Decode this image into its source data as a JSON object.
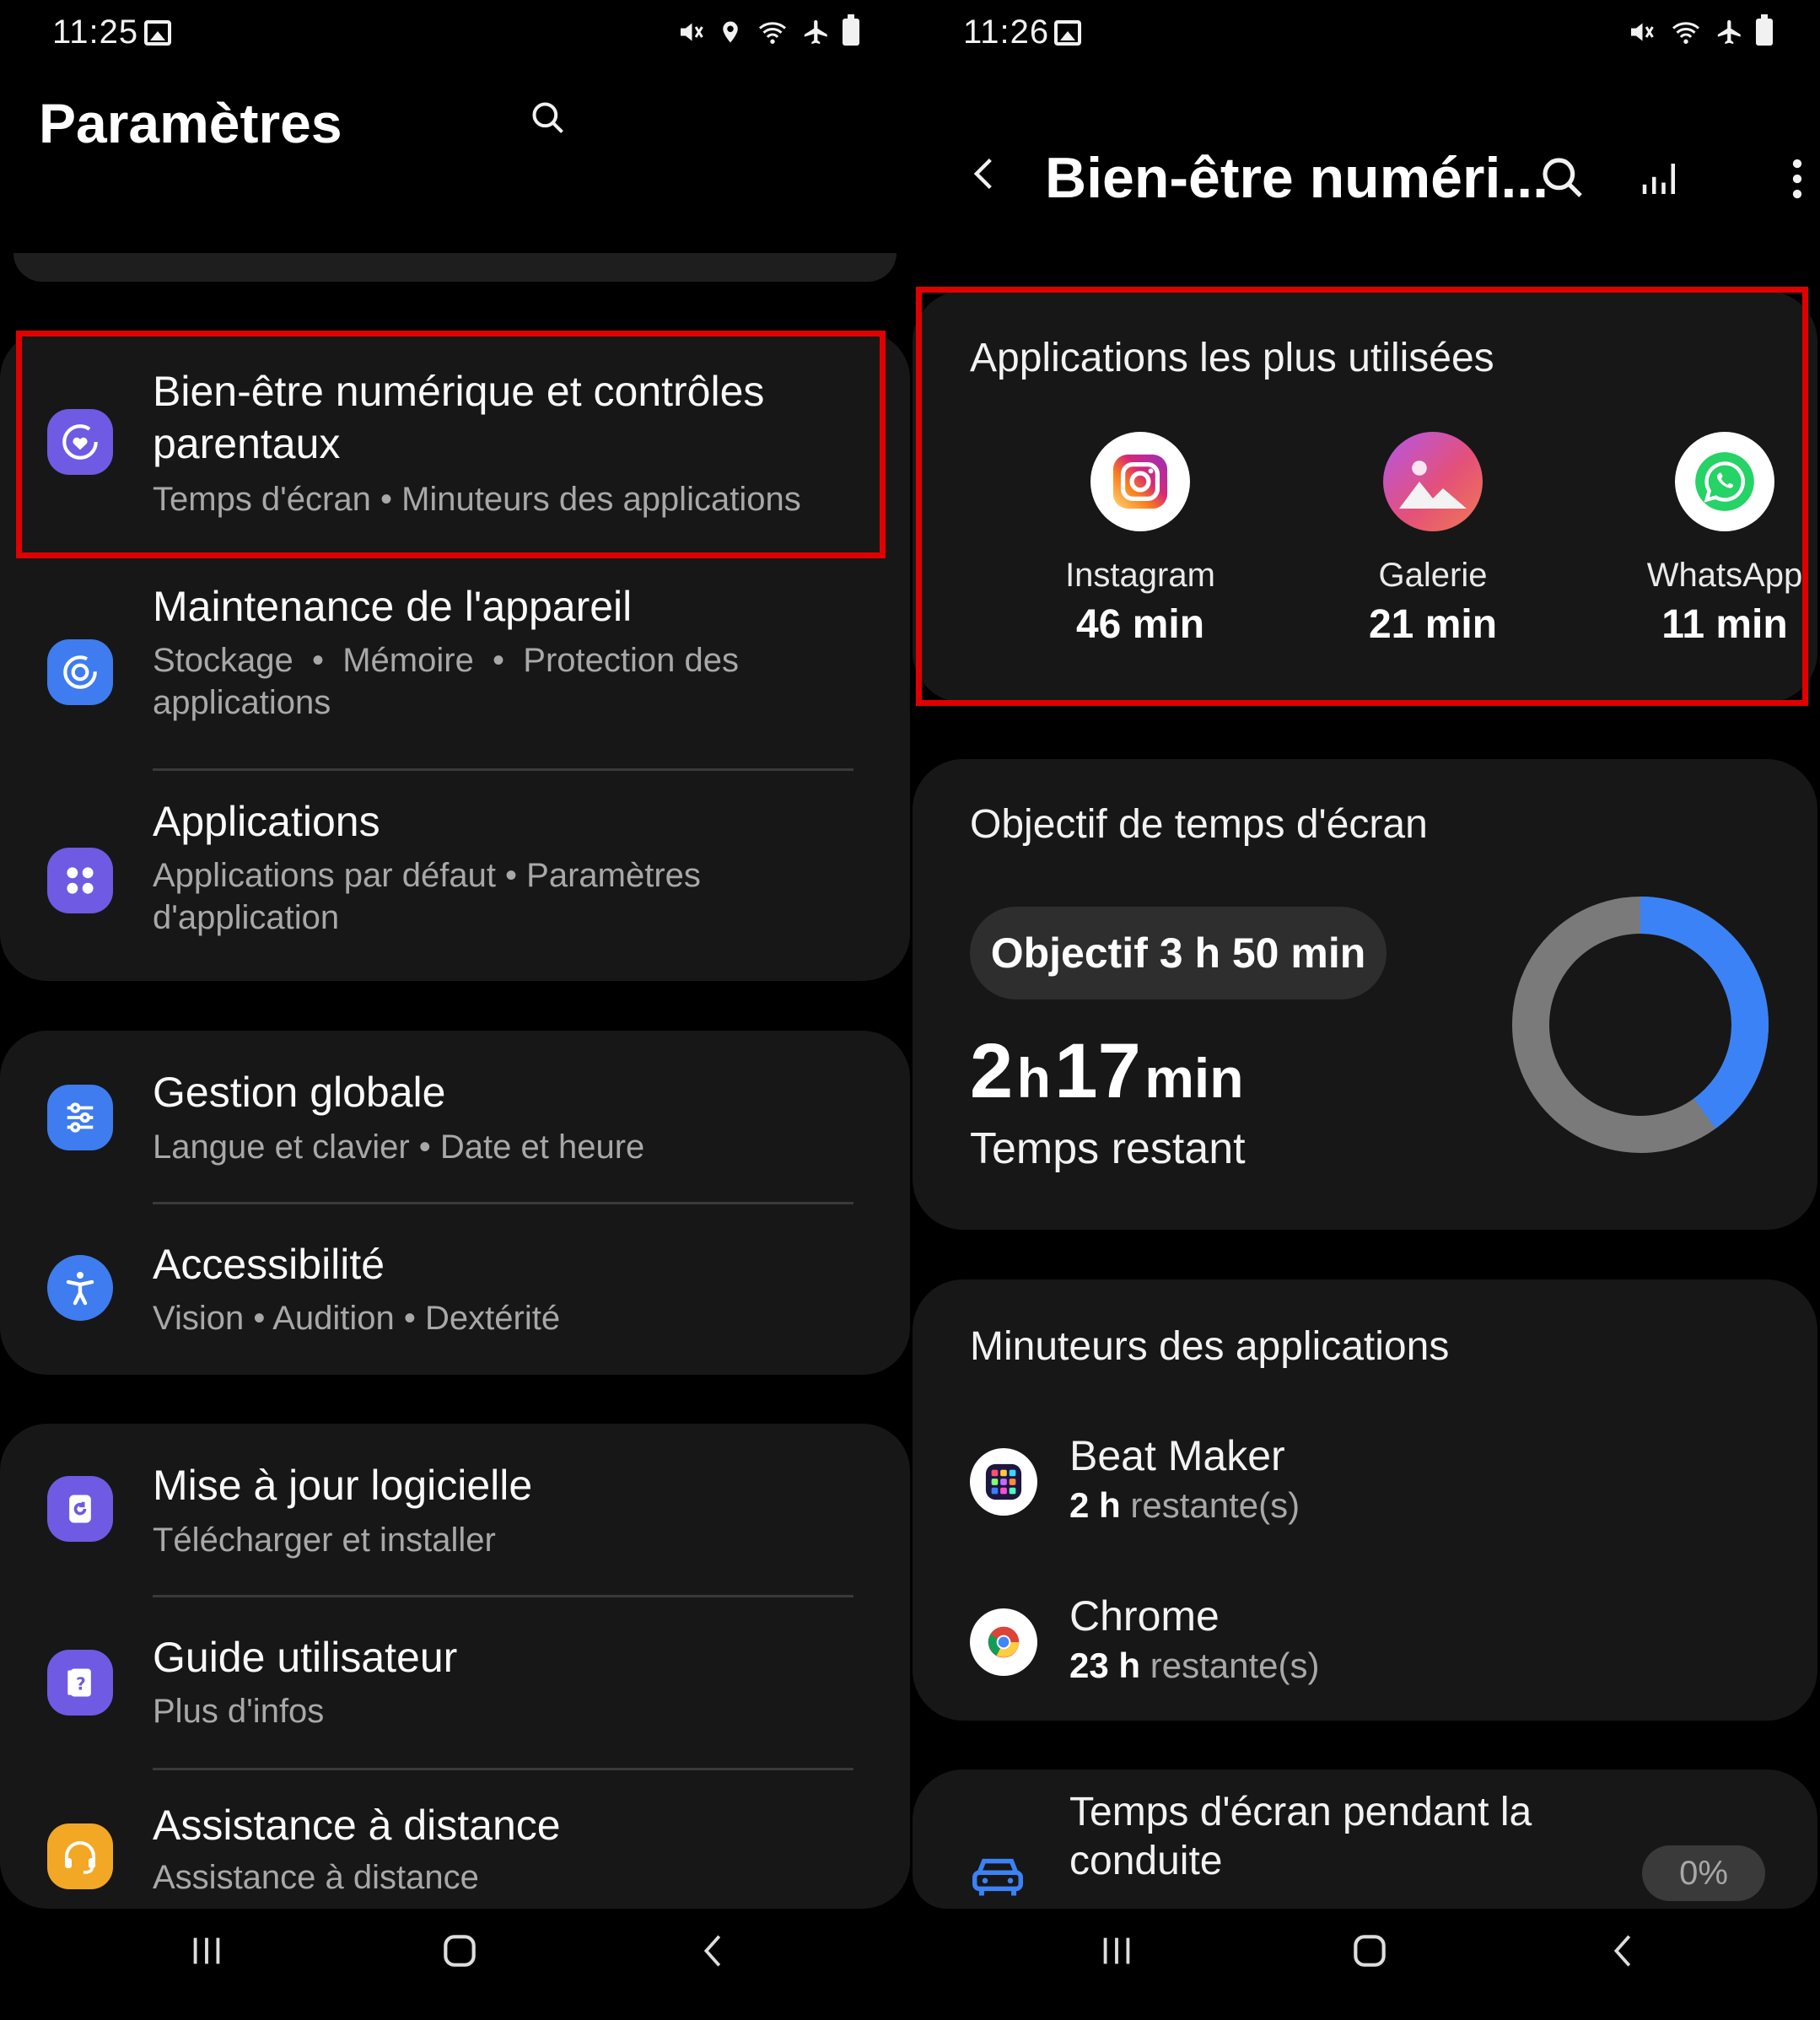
{
  "left": {
    "status": {
      "time": "11:25"
    },
    "header": {
      "title": "Paramètres"
    },
    "items": [
      {
        "title": "Bien-être numérique et contrôles parentaux",
        "sub": "Temps d'écran  •  Minuteurs des applications",
        "icon": "digital-wellbeing-icon",
        "color": "#6f5ae3"
      },
      {
        "title": "Maintenance de l'appareil",
        "sub": "Stockage  •  Mémoire  •  Protection des applications",
        "icon": "device-care-icon",
        "color": "#3e7cf0"
      },
      {
        "title": "Applications",
        "sub": "Applications par défaut  •  Paramètres d'application",
        "icon": "apps-grid-icon",
        "color": "#6f5ae3"
      },
      {
        "title": "Gestion globale",
        "sub": "Langue et clavier  •  Date et heure",
        "icon": "sliders-icon",
        "color": "#3e7cf0"
      },
      {
        "title": "Accessibilité",
        "sub": "Vision  •  Audition  •  Dextérité",
        "icon": "accessibility-icon",
        "color": "#3e7cf0"
      },
      {
        "title": "Mise à jour logicielle",
        "sub": "Télécharger et installer",
        "icon": "software-update-icon",
        "color": "#6f5ae3"
      },
      {
        "title": "Guide utilisateur",
        "sub": "Plus d'infos",
        "icon": "user-guide-icon",
        "color": "#6f5ae3"
      },
      {
        "title": "Assistance à distance",
        "sub": "Assistance à distance",
        "icon": "headset-icon",
        "color": "#f2a825"
      }
    ]
  },
  "right": {
    "status": {
      "time": "11:26"
    },
    "header": {
      "title": "Bien-être numéri..."
    },
    "most_used": {
      "title": "Applications les plus utilisées",
      "apps": [
        {
          "name": "Instagram",
          "duration": "46 min"
        },
        {
          "name": "Galerie",
          "duration": "21 min"
        },
        {
          "name": "WhatsApp",
          "duration": "11 min"
        }
      ]
    },
    "goal": {
      "title": "Objectif de temps d'écran",
      "pill": "Objectif 3 h 50 min",
      "hours": "2",
      "hours_unit": "h",
      "minutes": "17",
      "minutes_unit": "min",
      "remaining_label": "Temps restant",
      "used_fraction": 0.4
    },
    "timers": {
      "title": "Minuteurs des applications",
      "apps": [
        {
          "name": "Beat Maker",
          "value": "2 h",
          "suffix": "restante(s)"
        },
        {
          "name": "Chrome",
          "value": "23 h",
          "suffix": "restante(s)"
        }
      ]
    },
    "driving": {
      "title_line1": "Temps d'écran pendant la",
      "title_line2": "conduite",
      "badge": "0%"
    }
  },
  "colors": {
    "accent_blue": "#3b82f6",
    "ring_gray": "#7a7a7a",
    "highlight_red": "#e00000",
    "card_bg": "#171717"
  }
}
